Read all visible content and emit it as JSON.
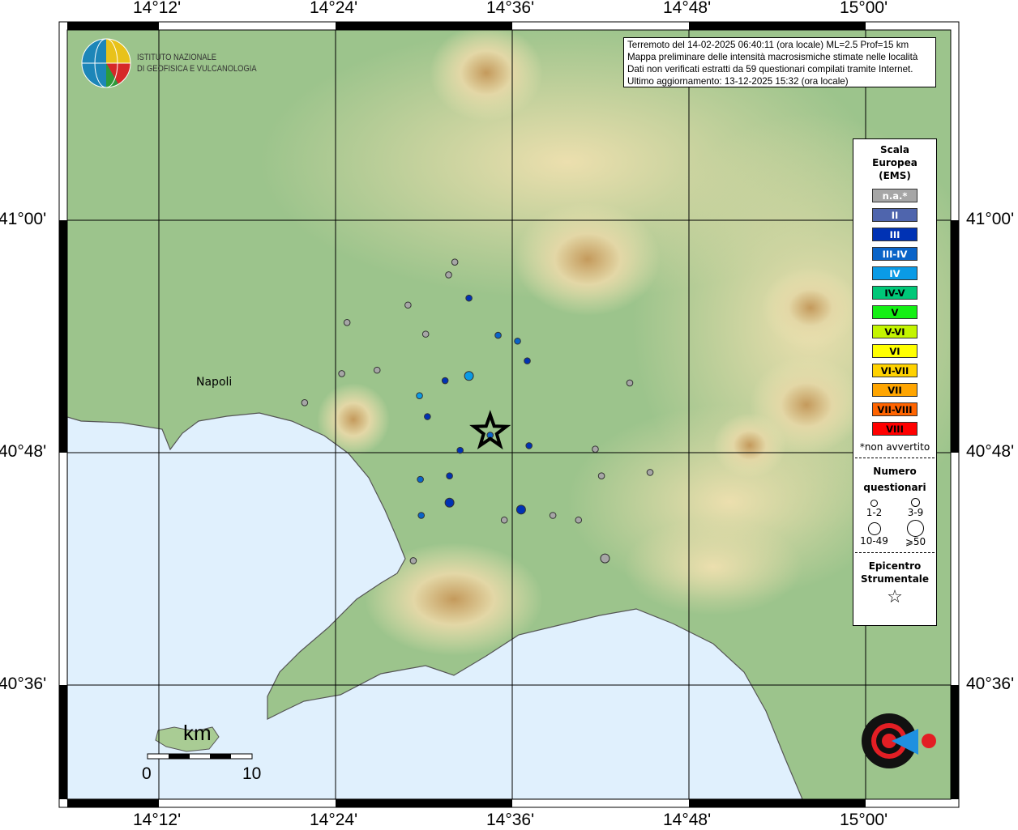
{
  "map": {
    "lon_ticks": [
      "14°12'",
      "14°24'",
      "14°36'",
      "14°48'",
      "15°00'"
    ],
    "lat_ticks": [
      "41°00'",
      "40°48'",
      "40°36'"
    ],
    "place_labels": [
      {
        "name": "Napoli",
        "lon": 14.25,
        "lat": 40.85
      }
    ],
    "colors": {
      "land": "#9cc48c",
      "sea": "#e0f0fd",
      "highland": "#c9a46a",
      "coast": "#555555"
    }
  },
  "info": {
    "line1": "Terremoto del 14-02-2025 06:40:11 (ora locale) ML=2.5 Prof=15 km",
    "line2": "Mappa preliminare delle intensità macrosismiche stimate nelle località",
    "line3": "Dati non verificati estratti da 59 questionari compilati tramite Internet.",
    "line4": "Ultimo aggiornamento: 13-12-2025 15:32 (ora locale)"
  },
  "logos": {
    "ingv": {
      "line1": "ISTITUTO NAZIONALE",
      "line2": "DI GEOFISICA E VULCANOLOGIA"
    },
    "hsit": "www.haisentitoilterremoto.it"
  },
  "legend": {
    "title_lines": [
      "Scala",
      "Europea",
      "(EMS)"
    ],
    "classes": [
      {
        "label": "n.a.*",
        "color": "#a6a6a6",
        "text": "#ffffff"
      },
      {
        "label": "II",
        "color": "#4f65ad",
        "text": "#ffffff"
      },
      {
        "label": "III",
        "color": "#0032b4",
        "text": "#ffffff"
      },
      {
        "label": "III-IV",
        "color": "#0a64c8",
        "text": "#ffffff"
      },
      {
        "label": "IV",
        "color": "#0a9be6",
        "text": "#ffffff"
      },
      {
        "label": "IV-V",
        "color": "#00c878",
        "text": "#000000"
      },
      {
        "label": "V",
        "color": "#14f014",
        "text": "#000000"
      },
      {
        "label": "V-VI",
        "color": "#c3f500",
        "text": "#000000"
      },
      {
        "label": "VI",
        "color": "#ffff00",
        "text": "#000000"
      },
      {
        "label": "VI-VII",
        "color": "#ffd200",
        "text": "#000000"
      },
      {
        "label": "VII",
        "color": "#ffa500",
        "text": "#000000"
      },
      {
        "label": "VII-VIII",
        "color": "#ff6400",
        "text": "#000000"
      },
      {
        "label": "VIII",
        "color": "#ff0000",
        "text": "#000000"
      }
    ],
    "footnote": "*non avvertito",
    "count_title_lines": [
      "Numero",
      "questionari"
    ],
    "count_classes": [
      "1-2",
      "3-9",
      "10-49",
      "⩾50"
    ],
    "epicenter_title_lines": [
      "Epicentro",
      "Strumentale"
    ]
  },
  "scale_bar": {
    "unit": "km",
    "min": "0",
    "max": "10"
  },
  "epicenter": {
    "lon": 14.575,
    "lat": 40.818
  },
  "observations": [
    {
      "lon": 14.535,
      "lat": 40.964,
      "ems": "n.a.*",
      "count": "1-2"
    },
    {
      "lon": 14.528,
      "lat": 40.953,
      "ems": "n.a.*",
      "count": "1-2"
    },
    {
      "lon": 14.551,
      "lat": 40.933,
      "ems": "III",
      "count": "1-2"
    },
    {
      "lon": 14.482,
      "lat": 40.927,
      "ems": "n.a.*",
      "count": "1-2"
    },
    {
      "lon": 14.413,
      "lat": 40.912,
      "ems": "n.a.*",
      "count": "1-2"
    },
    {
      "lon": 14.502,
      "lat": 40.902,
      "ems": "n.a.*",
      "count": "1-2"
    },
    {
      "lon": 14.584,
      "lat": 40.901,
      "ems": "III-IV",
      "count": "1-2"
    },
    {
      "lon": 14.606,
      "lat": 40.896,
      "ems": "III-IV",
      "count": "1-2"
    },
    {
      "lon": 14.617,
      "lat": 40.879,
      "ems": "III",
      "count": "1-2"
    },
    {
      "lon": 14.407,
      "lat": 40.868,
      "ems": "n.a.*",
      "count": "1-2"
    },
    {
      "lon": 14.447,
      "lat": 40.871,
      "ems": "n.a.*",
      "count": "1-2"
    },
    {
      "lon": 14.524,
      "lat": 40.862,
      "ems": "III",
      "count": "1-2"
    },
    {
      "lon": 14.551,
      "lat": 40.866,
      "ems": "IV",
      "count": "3-9"
    },
    {
      "lon": 14.495,
      "lat": 40.849,
      "ems": "IV",
      "count": "1-2"
    },
    {
      "lon": 14.365,
      "lat": 40.843,
      "ems": "n.a.*",
      "count": "1-2"
    },
    {
      "lon": 14.504,
      "lat": 40.831,
      "ems": "III",
      "count": "1-2"
    },
    {
      "lon": 14.575,
      "lat": 40.815,
      "ems": "III-IV",
      "count": "1-2"
    },
    {
      "lon": 14.541,
      "lat": 40.802,
      "ems": "III",
      "count": "1-2"
    },
    {
      "lon": 14.619,
      "lat": 40.806,
      "ems": "III",
      "count": "1-2"
    },
    {
      "lon": 14.733,
      "lat": 40.86,
      "ems": "n.a.*",
      "count": "1-2"
    },
    {
      "lon": 14.694,
      "lat": 40.803,
      "ems": "n.a.*",
      "count": "1-2"
    },
    {
      "lon": 14.701,
      "lat": 40.78,
      "ems": "n.a.*",
      "count": "1-2"
    },
    {
      "lon": 14.756,
      "lat": 40.783,
      "ems": "n.a.*",
      "count": "1-2"
    },
    {
      "lon": 14.496,
      "lat": 40.777,
      "ems": "III-IV",
      "count": "1-2"
    },
    {
      "lon": 14.529,
      "lat": 40.78,
      "ems": "III",
      "count": "1-2"
    },
    {
      "lon": 14.529,
      "lat": 40.757,
      "ems": "III",
      "count": "3-9"
    },
    {
      "lon": 14.61,
      "lat": 40.751,
      "ems": "III",
      "count": "3-9"
    },
    {
      "lon": 14.497,
      "lat": 40.746,
      "ems": "III-IV",
      "count": "1-2"
    },
    {
      "lon": 14.591,
      "lat": 40.742,
      "ems": "n.a.*",
      "count": "1-2"
    },
    {
      "lon": 14.646,
      "lat": 40.746,
      "ems": "n.a.*",
      "count": "1-2"
    },
    {
      "lon": 14.675,
      "lat": 40.742,
      "ems": "n.a.*",
      "count": "1-2"
    },
    {
      "lon": 14.488,
      "lat": 40.707,
      "ems": "n.a.*",
      "count": "1-2"
    },
    {
      "lon": 14.705,
      "lat": 40.709,
      "ems": "n.a.*",
      "count": "3-9"
    }
  ]
}
